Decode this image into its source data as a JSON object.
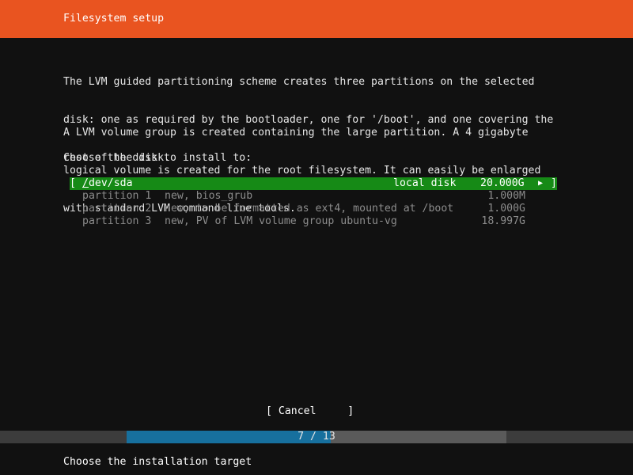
{
  "header": {
    "title": "Filesystem setup"
  },
  "intro": {
    "lines": [
      "The LVM guided partitioning scheme creates three partitions on the selected",
      "disk: one as required by the bootloader, one for '/boot', and one covering the",
      "rest of the disk."
    ]
  },
  "details": {
    "lines": [
      "A LVM volume group is created containing the large partition. A 4 gigabyte",
      "logical volume is created for the root filesystem. It can easily be enlarged",
      "with standard LVM command line tools."
    ]
  },
  "prompt": "Choose the disk to install to:",
  "disk": {
    "open_bracket": "[",
    "name_first": "/",
    "name_rest": "dev/sda",
    "type": "local disk",
    "size": "20.000G",
    "arrow": "▶",
    "close_bracket": "]"
  },
  "partitions": [
    {
      "label": "partition 1",
      "desc": "new, bios_grub",
      "size": "1.000M"
    },
    {
      "label": "partition 2",
      "desc": "new, to be formatted as ext4, mounted at /boot",
      "size": "1.000G"
    },
    {
      "label": "partition 3",
      "desc": "new, PV of LVM volume group ubuntu-vg",
      "size": "18.997G"
    }
  ],
  "cancel_button": {
    "label": "[ Cancel     ]"
  },
  "progress": {
    "text": "7 / 13",
    "current": 7,
    "total": 13
  },
  "status": "Choose the installation target",
  "colors": {
    "header": "#e95420",
    "selected_row": "#168a16",
    "progress_fill": "#17709e",
    "background": "#111111"
  }
}
